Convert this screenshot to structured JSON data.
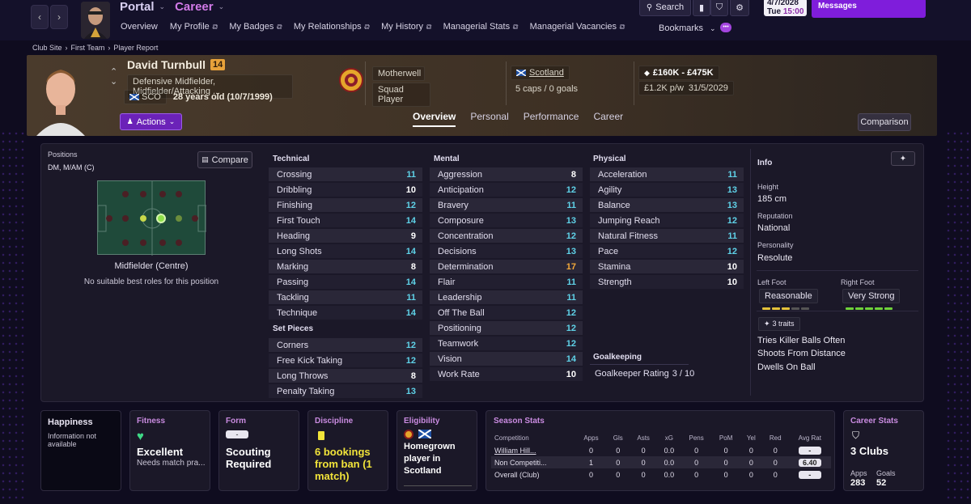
{
  "topbar": {
    "portal": "Portal",
    "career": "Career",
    "nav": [
      "Overview",
      "My Profile",
      "My Badges",
      "My Relationships",
      "My History",
      "Managerial Stats",
      "Managerial Vacancies"
    ],
    "search": "Search",
    "bookmarks": "Bookmarks",
    "date": "4/7/2028",
    "day": "Tue",
    "time": "15:00",
    "messages": "Messages"
  },
  "breadcrumb": [
    "Club Site",
    "First Team",
    "Player Report"
  ],
  "player": {
    "name": "David Turnbull",
    "number": "14",
    "positions_text": "Defensive Midfielder, Midfielder/Attacking ...",
    "nation_code": "SCO",
    "age": "28 years old (10/7/1999)",
    "club": "Motherwell",
    "squad_status": "Squad Player",
    "country": "Scotland",
    "caps": "5 caps / 0 goals",
    "value": "£160K - £475K",
    "wage": "£1.2K p/w",
    "contract": "31/5/2029",
    "actions": "Actions",
    "comparison": "Comparison"
  },
  "tabs": [
    "Overview",
    "Personal",
    "Performance",
    "Career"
  ],
  "positions": {
    "label": "Positions",
    "value": "DM, M/AM (C)",
    "compare": "Compare",
    "role": "Midfielder (Centre)",
    "note": "No suitable best roles for this position"
  },
  "technical": {
    "title": "Technical",
    "rows": [
      {
        "name": "Crossing",
        "val": "11",
        "tone": "hi"
      },
      {
        "name": "Dribbling",
        "val": "10",
        "tone": "mid"
      },
      {
        "name": "Finishing",
        "val": "12",
        "tone": "hi"
      },
      {
        "name": "First Touch",
        "val": "14",
        "tone": "hi"
      },
      {
        "name": "Heading",
        "val": "9",
        "tone": "mid"
      },
      {
        "name": "Long Shots",
        "val": "14",
        "tone": "hi"
      },
      {
        "name": "Marking",
        "val": "8",
        "tone": "mid"
      },
      {
        "name": "Passing",
        "val": "14",
        "tone": "hi"
      },
      {
        "name": "Tackling",
        "val": "11",
        "tone": "hi"
      },
      {
        "name": "Technique",
        "val": "14",
        "tone": "hi"
      }
    ]
  },
  "set_pieces": {
    "title": "Set Pieces",
    "rows": [
      {
        "name": "Corners",
        "val": "12",
        "tone": "hi"
      },
      {
        "name": "Free Kick Taking",
        "val": "12",
        "tone": "hi"
      },
      {
        "name": "Long Throws",
        "val": "8",
        "tone": "mid"
      },
      {
        "name": "Penalty Taking",
        "val": "13",
        "tone": "hi"
      }
    ]
  },
  "mental": {
    "title": "Mental",
    "rows": [
      {
        "name": "Aggression",
        "val": "8",
        "tone": "mid"
      },
      {
        "name": "Anticipation",
        "val": "12",
        "tone": "hi"
      },
      {
        "name": "Bravery",
        "val": "11",
        "tone": "hi"
      },
      {
        "name": "Composure",
        "val": "13",
        "tone": "hi"
      },
      {
        "name": "Concentration",
        "val": "12",
        "tone": "hi"
      },
      {
        "name": "Decisions",
        "val": "13",
        "tone": "hi"
      },
      {
        "name": "Determination",
        "val": "17",
        "tone": "or"
      },
      {
        "name": "Flair",
        "val": "11",
        "tone": "hi"
      },
      {
        "name": "Leadership",
        "val": "11",
        "tone": "hi"
      },
      {
        "name": "Off The Ball",
        "val": "12",
        "tone": "hi"
      },
      {
        "name": "Positioning",
        "val": "12",
        "tone": "hi"
      },
      {
        "name": "Teamwork",
        "val": "12",
        "tone": "hi"
      },
      {
        "name": "Vision",
        "val": "14",
        "tone": "hi"
      },
      {
        "name": "Work Rate",
        "val": "10",
        "tone": "mid"
      }
    ]
  },
  "physical": {
    "title": "Physical",
    "rows": [
      {
        "name": "Acceleration",
        "val": "11",
        "tone": "hi"
      },
      {
        "name": "Agility",
        "val": "13",
        "tone": "hi"
      },
      {
        "name": "Balance",
        "val": "13",
        "tone": "hi"
      },
      {
        "name": "Jumping Reach",
        "val": "12",
        "tone": "hi"
      },
      {
        "name": "Natural Fitness",
        "val": "11",
        "tone": "hi"
      },
      {
        "name": "Pace",
        "val": "12",
        "tone": "hi"
      },
      {
        "name": "Stamina",
        "val": "10",
        "tone": "mid"
      },
      {
        "name": "Strength",
        "val": "10",
        "tone": "mid"
      }
    ]
  },
  "goalkeeping": {
    "title": "Goalkeeping",
    "label": "Goalkeeper Rating",
    "value": "3 / 10"
  },
  "info": {
    "title": "Info",
    "height_label": "Height",
    "height": "185 cm",
    "reputation_label": "Reputation",
    "reputation": "National",
    "personality_label": "Personality",
    "personality": "Resolute",
    "left_foot_label": "Left Foot",
    "left_foot": "Reasonable",
    "right_foot_label": "Right Foot",
    "right_foot": "Very Strong",
    "traits_label": "3 traits",
    "traits": [
      "Tries Killer Balls Often",
      "Shoots From Distance",
      "Dwells On Ball"
    ]
  },
  "cards": {
    "happiness": {
      "title": "Happiness",
      "text": "Information not available"
    },
    "fitness": {
      "title": "Fitness",
      "big": "Excellent",
      "sub": "Needs match pra..."
    },
    "form": {
      "title": "Form",
      "pill": "-",
      "big": "Scouting Required"
    },
    "discipline": {
      "title": "Discipline",
      "big": "6 bookings from ban (1 match)"
    },
    "eligibility": {
      "title": "Eligibility",
      "big": "Homegrown player in Scotland"
    },
    "season": {
      "title": "Season Stats",
      "headers": [
        "Competition",
        "Apps",
        "Gls",
        "Asts",
        "xG",
        "Pens",
        "PoM",
        "Yel",
        "Red",
        "Avg Rat"
      ],
      "rows": [
        [
          "William Hill...",
          "0",
          "0",
          "0",
          "0.0",
          "0",
          "0",
          "0",
          "0",
          "-"
        ],
        [
          "Non Competiti...",
          "1",
          "0",
          "0",
          "0.0",
          "0",
          "0",
          "0",
          "0",
          "6.40"
        ],
        [
          "Overall (Club)",
          "0",
          "0",
          "0",
          "0.0",
          "0",
          "0",
          "0",
          "0",
          "-"
        ]
      ]
    },
    "career": {
      "title": "Career Stats",
      "clubs": "3 Clubs",
      "apps_label": "Apps",
      "apps": "283",
      "goals_label": "Goals",
      "goals": "52"
    }
  },
  "colors": {
    "accent": "#6b22b8",
    "hi": "#5fd2e8",
    "orange": "#f3a93a"
  }
}
